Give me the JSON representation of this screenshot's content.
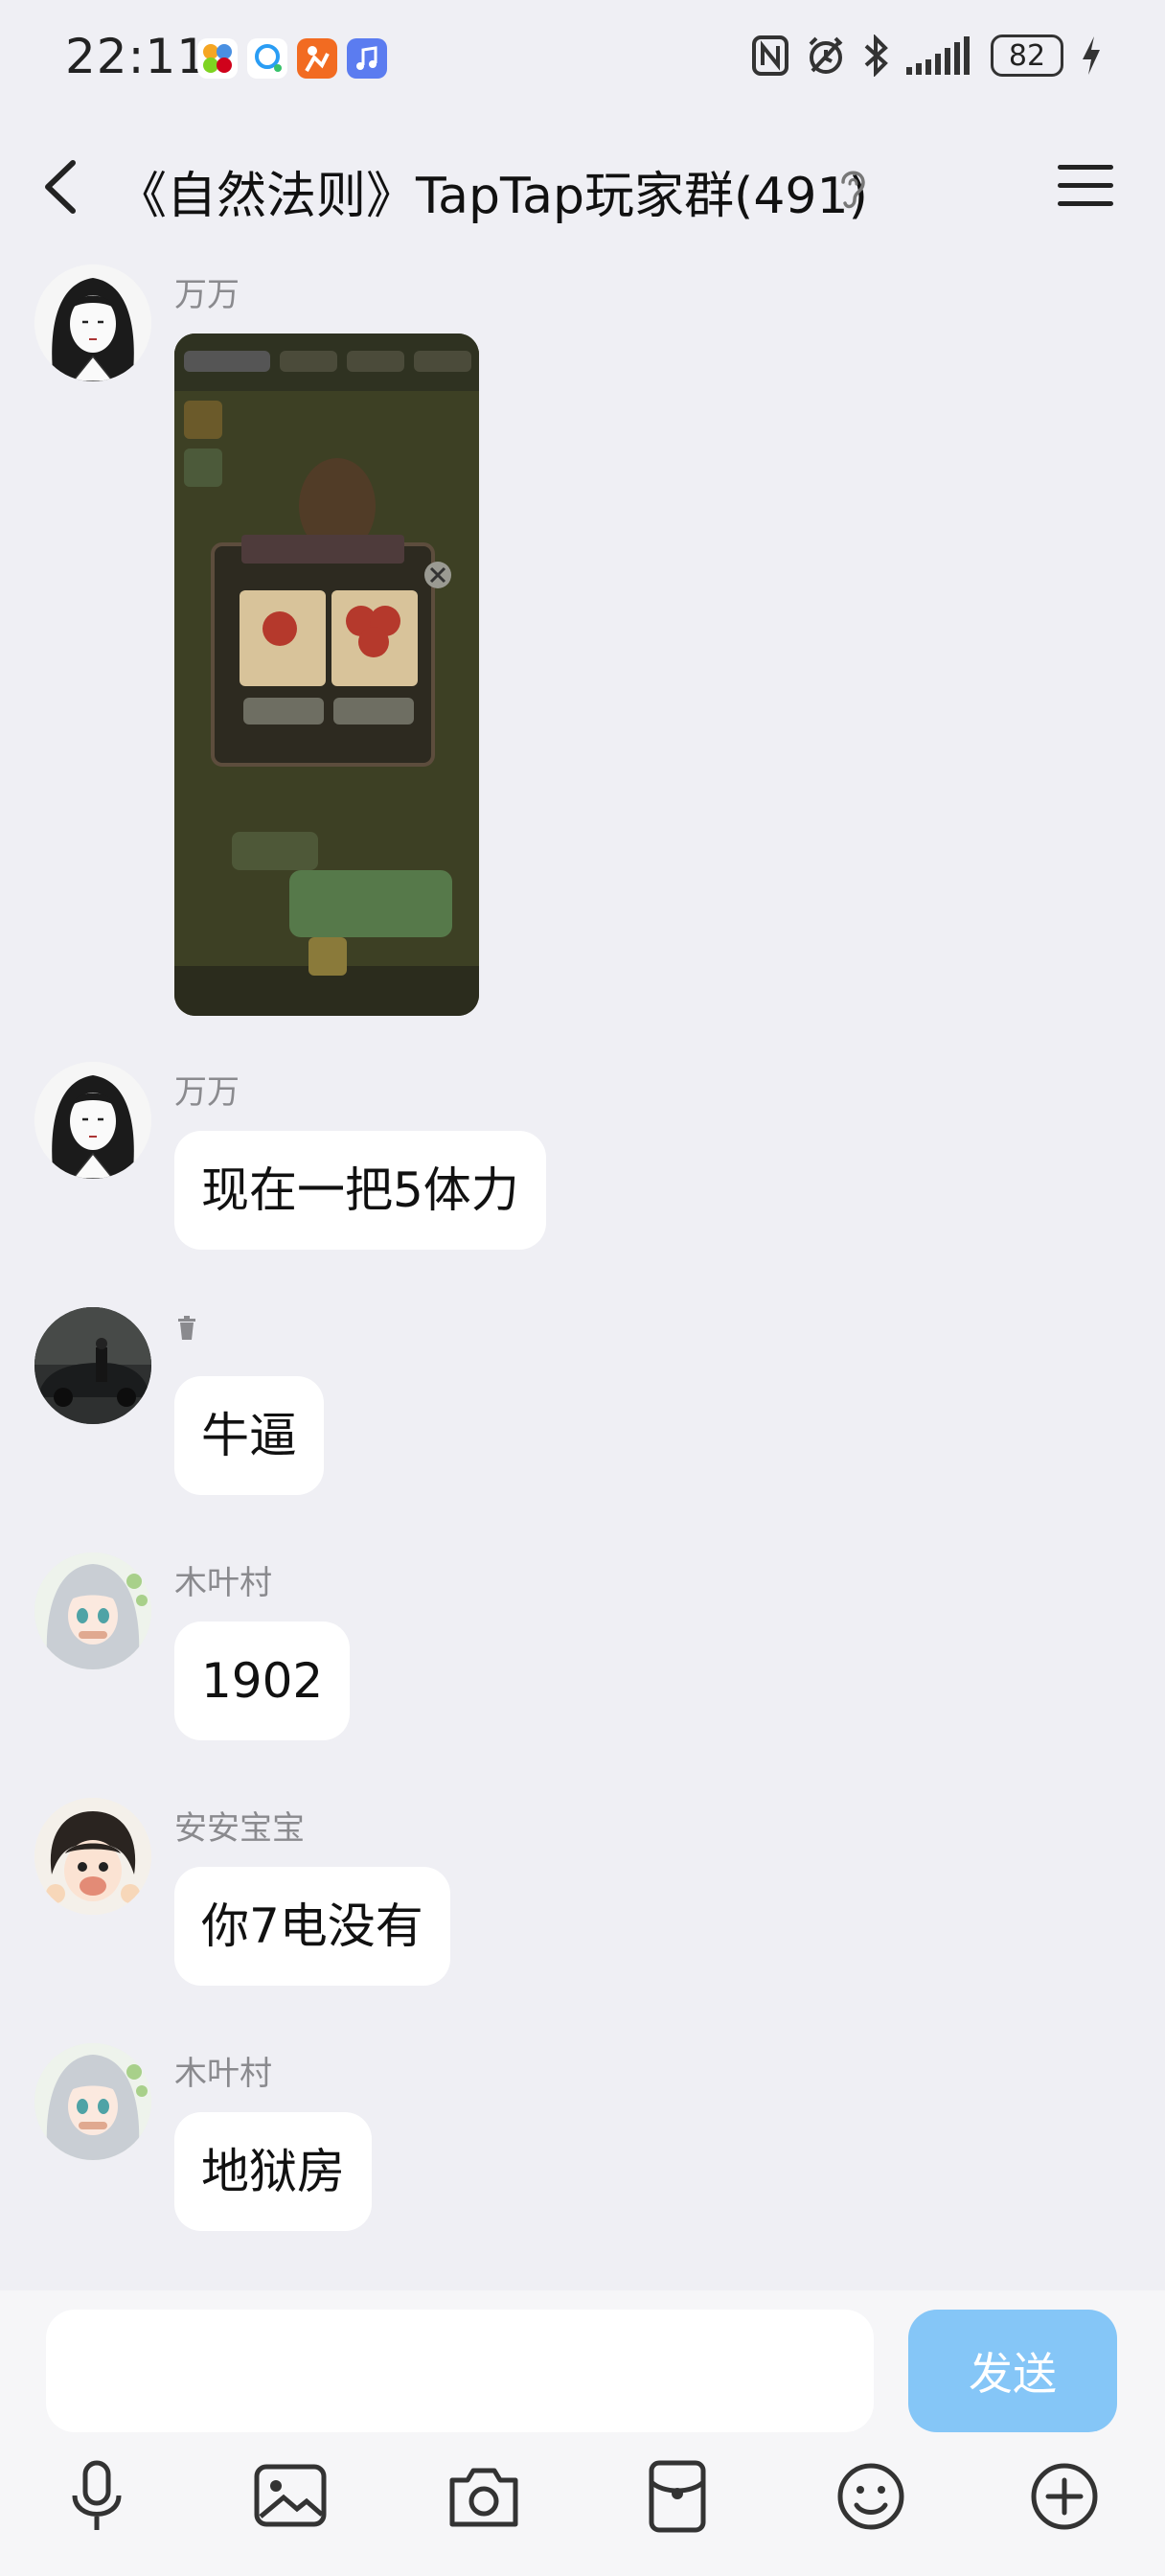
{
  "status_bar": {
    "time": "22:11",
    "battery": "82",
    "notification_icons": [
      "app-icon-a",
      "app-icon-b",
      "app-icon-c",
      "music-app-icon"
    ],
    "system_icons": [
      "nfc-icon",
      "alarm-icon",
      "bluetooth-icon",
      "signal-icon",
      "battery-icon",
      "charging-icon"
    ]
  },
  "header": {
    "title": "《自然法则》TapTap玩家群(491)",
    "back_icon": "chevron-left-icon",
    "ear_icon": "ear-icon",
    "menu_icon": "menu-icon"
  },
  "messages": [
    {
      "sender": "万万",
      "type": "image",
      "avatar": "anime-girl-avatar"
    },
    {
      "sender": "万万",
      "type": "text",
      "text": "现在一把5体力",
      "avatar": "anime-girl-avatar"
    },
    {
      "sender": "",
      "type": "text",
      "text": "牛逼",
      "avatar": "car-photo-avatar",
      "sender_badge": "trash-icon"
    },
    {
      "sender": "木叶村",
      "type": "text",
      "text": "1902",
      "avatar": "silver-hair-avatar"
    },
    {
      "sender": "安安宝宝",
      "type": "text",
      "text": "你7电没有",
      "avatar": "boy-avatar"
    },
    {
      "sender": "木叶村",
      "type": "text",
      "text": "地狱房",
      "avatar": "silver-hair-avatar"
    }
  ],
  "input": {
    "placeholder": "",
    "value": "",
    "send_label": "发送"
  },
  "toolbar": {
    "items": [
      "microphone-icon",
      "image-icon",
      "camera-icon",
      "red-packet-icon",
      "emoji-icon",
      "plus-icon"
    ]
  },
  "colors": {
    "background": "#efeff4",
    "bubble": "#ffffff",
    "send_button": "#85c6f7",
    "sender_name": "#8a8a8e"
  }
}
